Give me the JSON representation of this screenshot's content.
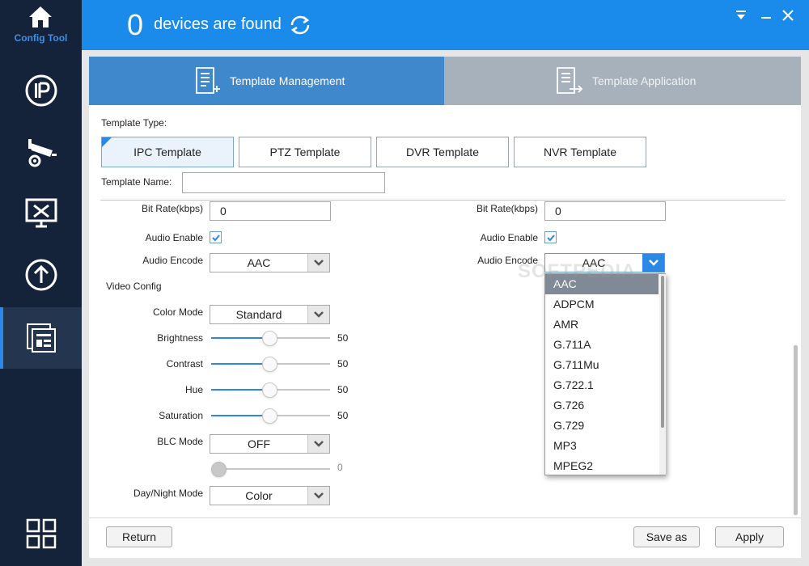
{
  "app": {
    "name": "Config Tool"
  },
  "header": {
    "device_count": "0",
    "found_text": "devices are found"
  },
  "tabs": [
    {
      "label": "Template Management",
      "active": true
    },
    {
      "label": "Template Application",
      "active": false
    }
  ],
  "template_type": {
    "label": "Template Type:",
    "options": [
      "IPC Template",
      "PTZ Template",
      "DVR Template",
      "NVR Template"
    ],
    "selected": "IPC Template"
  },
  "template_name": {
    "label": "Template Name:",
    "value": ""
  },
  "left": {
    "bitrate_label": "Bit Rate(kbps)",
    "bitrate_value": "0",
    "audio_enable_label": "Audio Enable",
    "audio_enable_checked": true,
    "audio_encode_label": "Audio Encode",
    "audio_encode_value": "AAC"
  },
  "right": {
    "bitrate_label": "Bit Rate(kbps)",
    "bitrate_value": "0",
    "audio_enable_label": "Audio Enable",
    "audio_enable_checked": true,
    "audio_encode_label": "Audio Encode",
    "audio_encode_value": "AAC"
  },
  "video_config": {
    "label": "Video Config",
    "color_mode_label": "Color Mode",
    "color_mode_value": "Standard",
    "brightness_label": "Brightness",
    "brightness_value": "50",
    "contrast_label": "Contrast",
    "contrast_value": "50",
    "hue_label": "Hue",
    "hue_value": "50",
    "saturation_label": "Saturation",
    "saturation_value": "50",
    "blc_label": "BLC Mode",
    "blc_value": "OFF",
    "blc_level_value": "0",
    "daynight_label": "Day/Night Mode",
    "daynight_value": "Color"
  },
  "audio_dropdown": {
    "options": [
      "AAC",
      "ADPCM",
      "AMR",
      "G.711A",
      "G.711Mu",
      "G.722.1",
      "G.726",
      "G.729",
      "MP3",
      "MPEG2"
    ],
    "selected": "AAC"
  },
  "footer": {
    "return_label": "Return",
    "save_as_label": "Save as",
    "apply_label": "Apply"
  },
  "watermark": "SOFTPEDIA",
  "colors": {
    "sidebar": "#15233a",
    "header": "#1a8bea",
    "tab_active": "#3f88cb",
    "tab_inactive": "#a7b1bb",
    "accent": "#2c88e6"
  }
}
